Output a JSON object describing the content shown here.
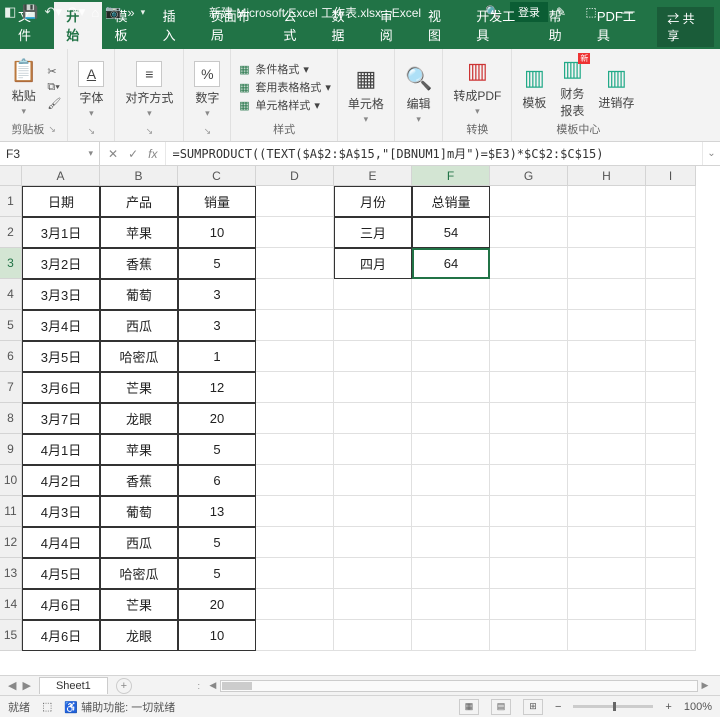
{
  "window": {
    "title_doc": "新建 Microsoft Excel 工作表.xlsx",
    "title_app": "Excel",
    "login_label": "登录"
  },
  "tabs": {
    "file": "文件",
    "home": "开始",
    "template": "模板",
    "insert": "插入",
    "layout": "页面布局",
    "formulas": "公式",
    "data": "数据",
    "review": "审阅",
    "view": "视图",
    "developer": "开发工具",
    "help": "帮助",
    "pdftools": "PDF工具",
    "share": "共享"
  },
  "ribbon": {
    "clipboard": {
      "paste": "粘贴",
      "group": "剪贴板"
    },
    "font": {
      "label": "字体",
      "group": ""
    },
    "align": {
      "label": "对齐方式"
    },
    "number": {
      "label": "数字"
    },
    "styles": {
      "cond": "条件格式",
      "tablefmt": "套用表格格式",
      "cellstyle": "单元格样式",
      "group": "样式"
    },
    "cells": {
      "label": "单元格"
    },
    "editing": {
      "label": "编辑"
    },
    "convert": {
      "btn": "转成PDF",
      "group": "转换"
    },
    "tmpl": {
      "tmpl": "模板",
      "finrpt": "财务\n报表",
      "purchase": "进销存",
      "group": "模板中心"
    }
  },
  "formula_bar": {
    "cell_ref": "F3",
    "formula": "=SUMPRODUCT((TEXT($A$2:$A$15,\"[DBNUM1]m月\")=$E3)*$C$2:$C$15)"
  },
  "columns": [
    "A",
    "B",
    "C",
    "D",
    "E",
    "F",
    "G",
    "H",
    "I"
  ],
  "rows": [
    "1",
    "2",
    "3",
    "4",
    "5",
    "6",
    "7",
    "8",
    "9",
    "10",
    "11",
    "12",
    "13",
    "14",
    "15"
  ],
  "table1": {
    "headers": {
      "date": "日期",
      "product": "产品",
      "sales": "销量"
    },
    "rows": [
      {
        "date": "3月1日",
        "product": "苹果",
        "sales": "10"
      },
      {
        "date": "3月2日",
        "product": "香蕉",
        "sales": "5"
      },
      {
        "date": "3月3日",
        "product": "葡萄",
        "sales": "3"
      },
      {
        "date": "3月4日",
        "product": "西瓜",
        "sales": "3"
      },
      {
        "date": "3月5日",
        "product": "哈密瓜",
        "sales": "1"
      },
      {
        "date": "3月6日",
        "product": "芒果",
        "sales": "12"
      },
      {
        "date": "3月7日",
        "product": "龙眼",
        "sales": "20"
      },
      {
        "date": "4月1日",
        "product": "苹果",
        "sales": "5"
      },
      {
        "date": "4月2日",
        "product": "香蕉",
        "sales": "6"
      },
      {
        "date": "4月3日",
        "product": "葡萄",
        "sales": "13"
      },
      {
        "date": "4月4日",
        "product": "西瓜",
        "sales": "5"
      },
      {
        "date": "4月5日",
        "product": "哈密瓜",
        "sales": "5"
      },
      {
        "date": "4月6日",
        "product": "芒果",
        "sales": "20"
      },
      {
        "date": "4月6日",
        "product": "龙眼",
        "sales": "10"
      }
    ]
  },
  "table2": {
    "headers": {
      "month": "月份",
      "total": "总销量"
    },
    "rows": [
      {
        "month": "三月",
        "total": "54"
      },
      {
        "month": "四月",
        "total": "64"
      }
    ]
  },
  "sheet": {
    "name": "Sheet1"
  },
  "status": {
    "ready": "就绪",
    "scroll": "",
    "access": "辅助功能: 一切就绪",
    "zoom": "100%"
  }
}
